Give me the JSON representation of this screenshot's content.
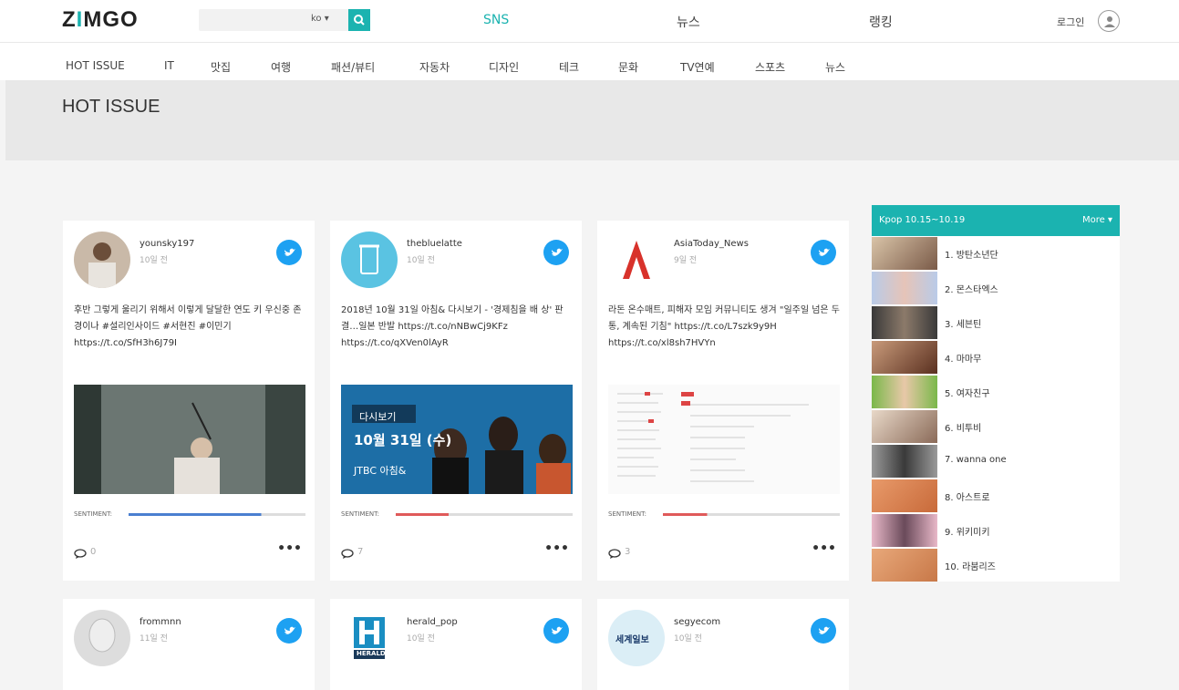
{
  "header": {
    "logo_text": "ZIMGO",
    "lang": "ko ▾",
    "nav": [
      "SNS",
      "뉴스",
      "랭킹"
    ],
    "login": "로그인",
    "accent": "#1bb3b0"
  },
  "categories": [
    "HOT ISSUE",
    "IT",
    "맛집",
    "여행",
    "패션/뷰티",
    "자동차",
    "디자인",
    "테크",
    "문화",
    "TV연예",
    "스포츠",
    "뉴스"
  ],
  "hero": {
    "title": "HOT ISSUE"
  },
  "cards": [
    {
      "user": "younsky197",
      "time": "10일 전",
      "text": "후반 그렇게 울리기 위해서 이렇게 달달한 연도 키 우신중 존경이나 #설리인사이드 #서현진 #이민기 https://t.co/SfH3h6J79I",
      "sentiment_label": "SENTIMENT:",
      "sentiment_color": "#4a7fd0",
      "comments": "0",
      "more": "•••",
      "image": "drama-photo"
    },
    {
      "user": "thebluelatte",
      "time": "10일 전",
      "text": "2018년 10월 31일 아침& 다시보기 - '경제침을 배 상' 판결…일본 반발 https://t.co/nNBwCj9KFz https://t.co/qXVen0lAyR",
      "sentiment_label": "SENTIMENT:",
      "sentiment_color": "#e05a5a",
      "comments": "7",
      "more": "•••",
      "image": "jtbc-banner",
      "banner": {
        "line1": "다시보기",
        "line2": "10월 31일 (수)",
        "brand": "JTBC 아침&"
      }
    },
    {
      "user": "AsiaToday_News",
      "time": "9일 전",
      "text": "라돈 온수매트, 피해자 모임 커뮤니티도 생겨 \"일주일 넘은 두통, 계속된 기침\" https://t.co/L7szk9y9H https://t.co/xl8sh7HVYn",
      "sentiment_label": "SENTIMENT:",
      "sentiment_color": "#e05a5a",
      "comments": "3",
      "more": "•••",
      "image": "document-screenshot"
    },
    {
      "user": "frommnn",
      "time": "11일 전"
    },
    {
      "user": "herald_pop",
      "time": "10일 전",
      "logo": "HERALD"
    },
    {
      "user": "segyecom",
      "time": "10일 전",
      "logo": "세계일보"
    }
  ],
  "sidebar": {
    "title": "Kpop 10.15~10.19",
    "more": "More ▾",
    "items": [
      "1. 방탄소년단",
      "2. 몬스타엑스",
      "3. 세븐틴",
      "4. 마마무",
      "5. 여자친구",
      "6. 비투비",
      "7. wanna one",
      "8. 아스트로",
      "9. 위키미키",
      "10. 라붐리즈"
    ]
  }
}
